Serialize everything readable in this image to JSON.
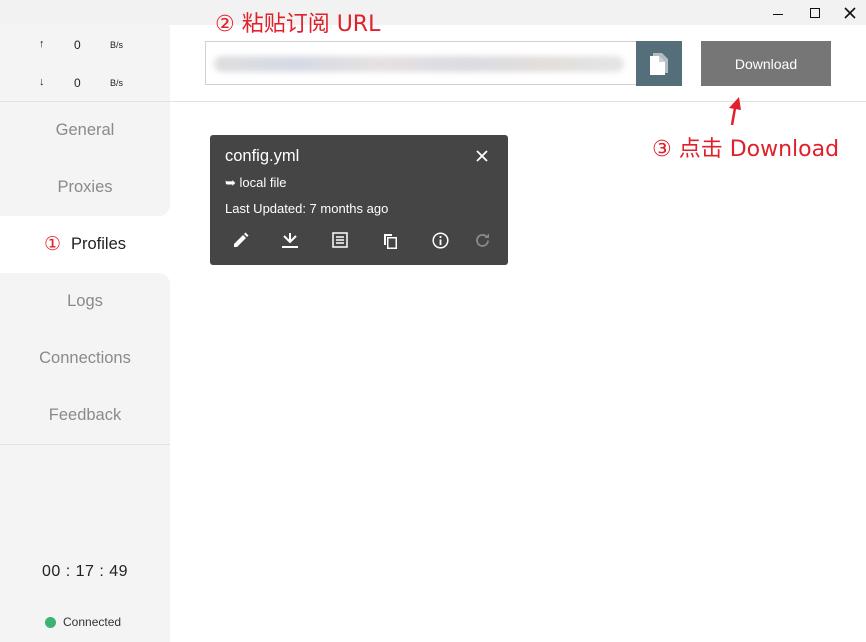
{
  "window": {
    "minimize_label": "minimize",
    "maximize_label": "maximize",
    "close_label": "close"
  },
  "traffic": {
    "up_arrow": "↑",
    "up_value": "0",
    "up_unit": "B/s",
    "down_arrow": "↓",
    "down_value": "0",
    "down_unit": "B/s"
  },
  "nav": {
    "items": [
      {
        "label": "General"
      },
      {
        "label": "Proxies"
      },
      {
        "label": "Profiles",
        "marker": "①"
      },
      {
        "label": "Logs"
      },
      {
        "label": "Connections"
      },
      {
        "label": "Feedback"
      }
    ],
    "active_index": 2
  },
  "status": {
    "uptime": "00 : 17 : 49",
    "connection": "Connected",
    "color": "#3cb371"
  },
  "subscription": {
    "url_value": "",
    "download_label": "Download",
    "paste_icon": "paste-icon"
  },
  "annotations": {
    "step2": "② 粘贴订阅 URL",
    "step3": "③ 点击 Download",
    "color": "#e0202a"
  },
  "profile_card": {
    "name": "config.yml",
    "type": "➥ local file",
    "updated": "Last Updated: 7 months ago",
    "actions": [
      "edit-icon",
      "download-update-icon",
      "list-icon",
      "copy-icon",
      "info-icon",
      "refresh-icon"
    ]
  }
}
